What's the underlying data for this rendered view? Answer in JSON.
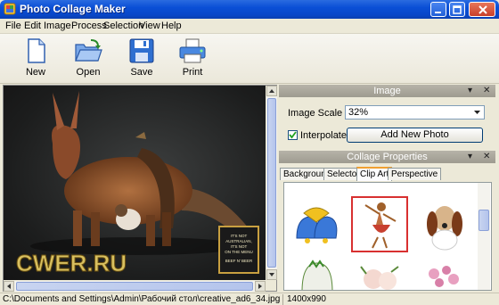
{
  "window": {
    "title": "Photo Collage Maker"
  },
  "menu": [
    "File",
    "Edit",
    "Image",
    "Process",
    "Selection",
    "View",
    "Help"
  ],
  "toolbar": {
    "new": "New",
    "open": "Open",
    "save": "Save",
    "print": "Print"
  },
  "image_panel": {
    "title": "Image",
    "scale_label": "Image Scale",
    "scale_value": "32%",
    "interpolate_label": "Interpolate",
    "interpolate_checked": true,
    "add_button": "Add New Photo"
  },
  "collage_panel": {
    "title": "Collage Properties",
    "tabs": [
      "Background",
      "Selector",
      "Clip Art",
      "Perspective"
    ],
    "active_tab": "Clip Art",
    "clipart_items": [
      "bells-clipart",
      "dancer-clipart",
      "dog-clipart",
      "ghost-clipart",
      "roses-clipart",
      "flowers-clipart"
    ]
  },
  "canvas": {
    "sign_text": [
      "IT'S NOT",
      "AUSTRALIAN,",
      "IT'S NOT",
      "ON THE MENU",
      "BEEF N' BEER"
    ],
    "watermark": "CWER.RU"
  },
  "status": {
    "path": "C:\\Documents and Settings\\Admin\\Рабочий стол\\creative_ad6_34.jpg",
    "dimensions": "1400x990"
  }
}
